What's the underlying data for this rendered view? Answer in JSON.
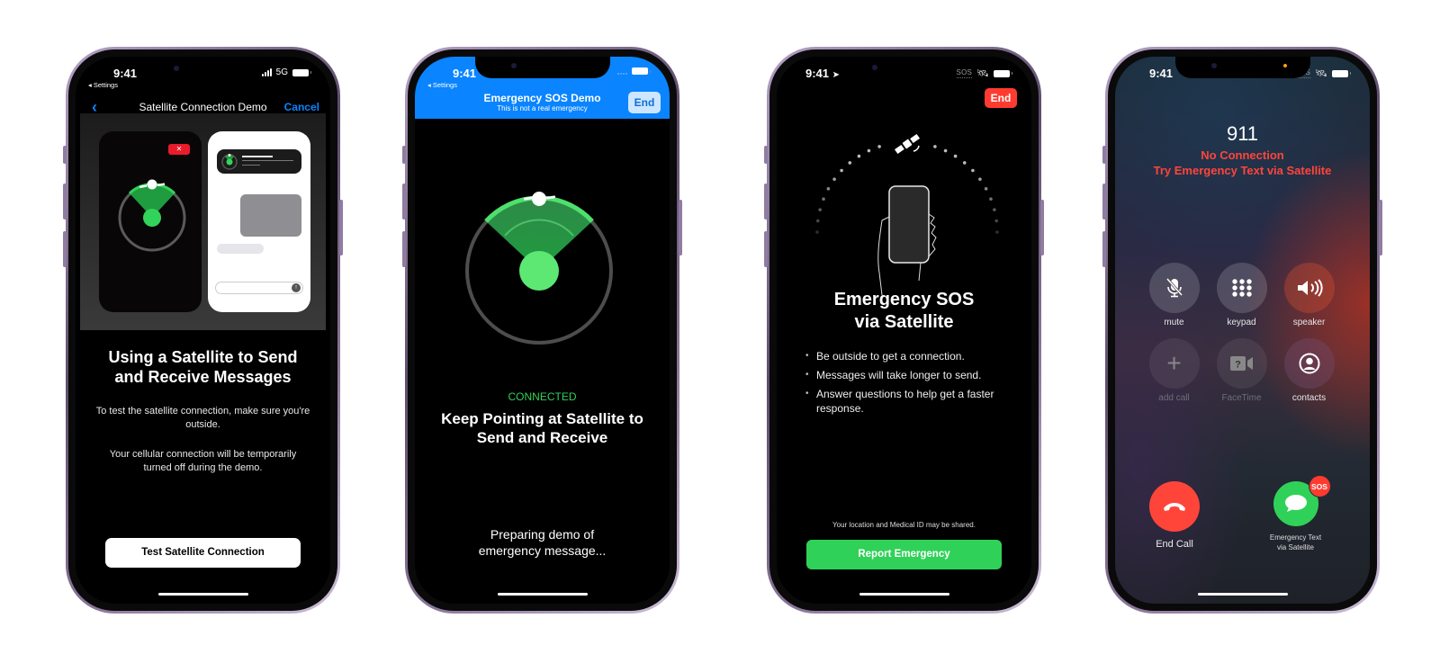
{
  "phones": [
    {
      "id": "satellite-demo-intro",
      "status": {
        "time": "9:41",
        "back_app": "◂ Settings",
        "network": "5G"
      },
      "nav": {
        "title": "Satellite Connection Demo",
        "cancel_label": "Cancel"
      },
      "illustration": {
        "mini_close_label": "✕",
        "send_icon": "↑"
      },
      "heading": "Using a Satellite to Send and Receive Messages",
      "paragraphs": [
        "To test the satellite connection, make sure you're outside.",
        "Your cellular connection will be temporarily turned off during the demo."
      ],
      "button_label": "Test Satellite Connection"
    },
    {
      "id": "sos-demo-connected",
      "status": {
        "time": "9:41",
        "back_app": "◂ Settings"
      },
      "header": {
        "title": "Emergency SOS Demo",
        "subtitle": "This is not a real emergency",
        "end_label": "End"
      },
      "connection_status": "CONNECTED",
      "heading": "Keep Pointing at Satellite to Send and Receive",
      "progress_text": "Preparing demo of emergency message..."
    },
    {
      "id": "sos-via-satellite",
      "status": {
        "time": "9:41",
        "sos": "SOS"
      },
      "end_label": "End",
      "heading": "Emergency SOS via Satellite",
      "bullets": [
        "Be outside to get a connection.",
        "Messages will take longer to send.",
        "Answer questions to help get a faster response."
      ],
      "share_note": "Your location and Medical ID may be shared.",
      "button_label": "Report Emergency"
    },
    {
      "id": "call-no-connection",
      "status": {
        "time": "9:41",
        "sos": "SOS"
      },
      "number": "911",
      "status_lines": [
        "No Connection",
        "Try Emergency Text via Satellite"
      ],
      "controls": [
        {
          "label": "mute",
          "icon": "mic-slash-icon",
          "glyph": "🎙",
          "enabled": true
        },
        {
          "label": "keypad",
          "icon": "keypad-icon",
          "glyph": "⠿",
          "enabled": true
        },
        {
          "label": "speaker",
          "icon": "speaker-icon",
          "glyph": "🔊",
          "enabled": true
        },
        {
          "label": "add call",
          "icon": "plus-icon",
          "glyph": "+",
          "enabled": false
        },
        {
          "label": "FaceTime",
          "icon": "facetime-icon",
          "glyph": "?▶",
          "enabled": false
        },
        {
          "label": "contacts",
          "icon": "contacts-icon",
          "glyph": "👤",
          "enabled": true
        }
      ],
      "end_call_label": "End Call",
      "satellite_text_label": "Emergency Text via Satellite",
      "sos_badge": "SOS"
    }
  ],
  "colors": {
    "ios_blue": "#0a84ff",
    "ios_green": "#30d158",
    "ios_red": "#ff3b30",
    "status_red": "#ff453a"
  }
}
